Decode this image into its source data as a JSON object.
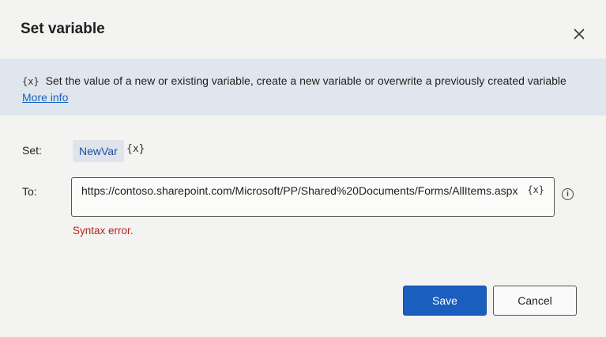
{
  "dialog": {
    "title": "Set variable",
    "close_icon": "close-icon",
    "info": {
      "var_icon": "{x}",
      "description": "Set the value of a new or existing variable, create a new variable or overwrite a previously created variable",
      "link_text": "More info"
    },
    "set": {
      "label": "Set:",
      "variable_name": "NewVar",
      "var_icon": "{x}"
    },
    "to": {
      "label": "To:",
      "value": "https://contoso.sharepoint.com/Microsoft/PP/Shared%20Documents/Forms/AllItems.aspx",
      "var_icon": "{x}",
      "info_icon": "i"
    },
    "error_text": "Syntax error.",
    "buttons": {
      "save": "Save",
      "cancel": "Cancel"
    },
    "colors": {
      "primary": "#1a5fbf",
      "error": "#b3261e",
      "link": "#1a62c4",
      "info_band": "#dfe6ee"
    }
  }
}
